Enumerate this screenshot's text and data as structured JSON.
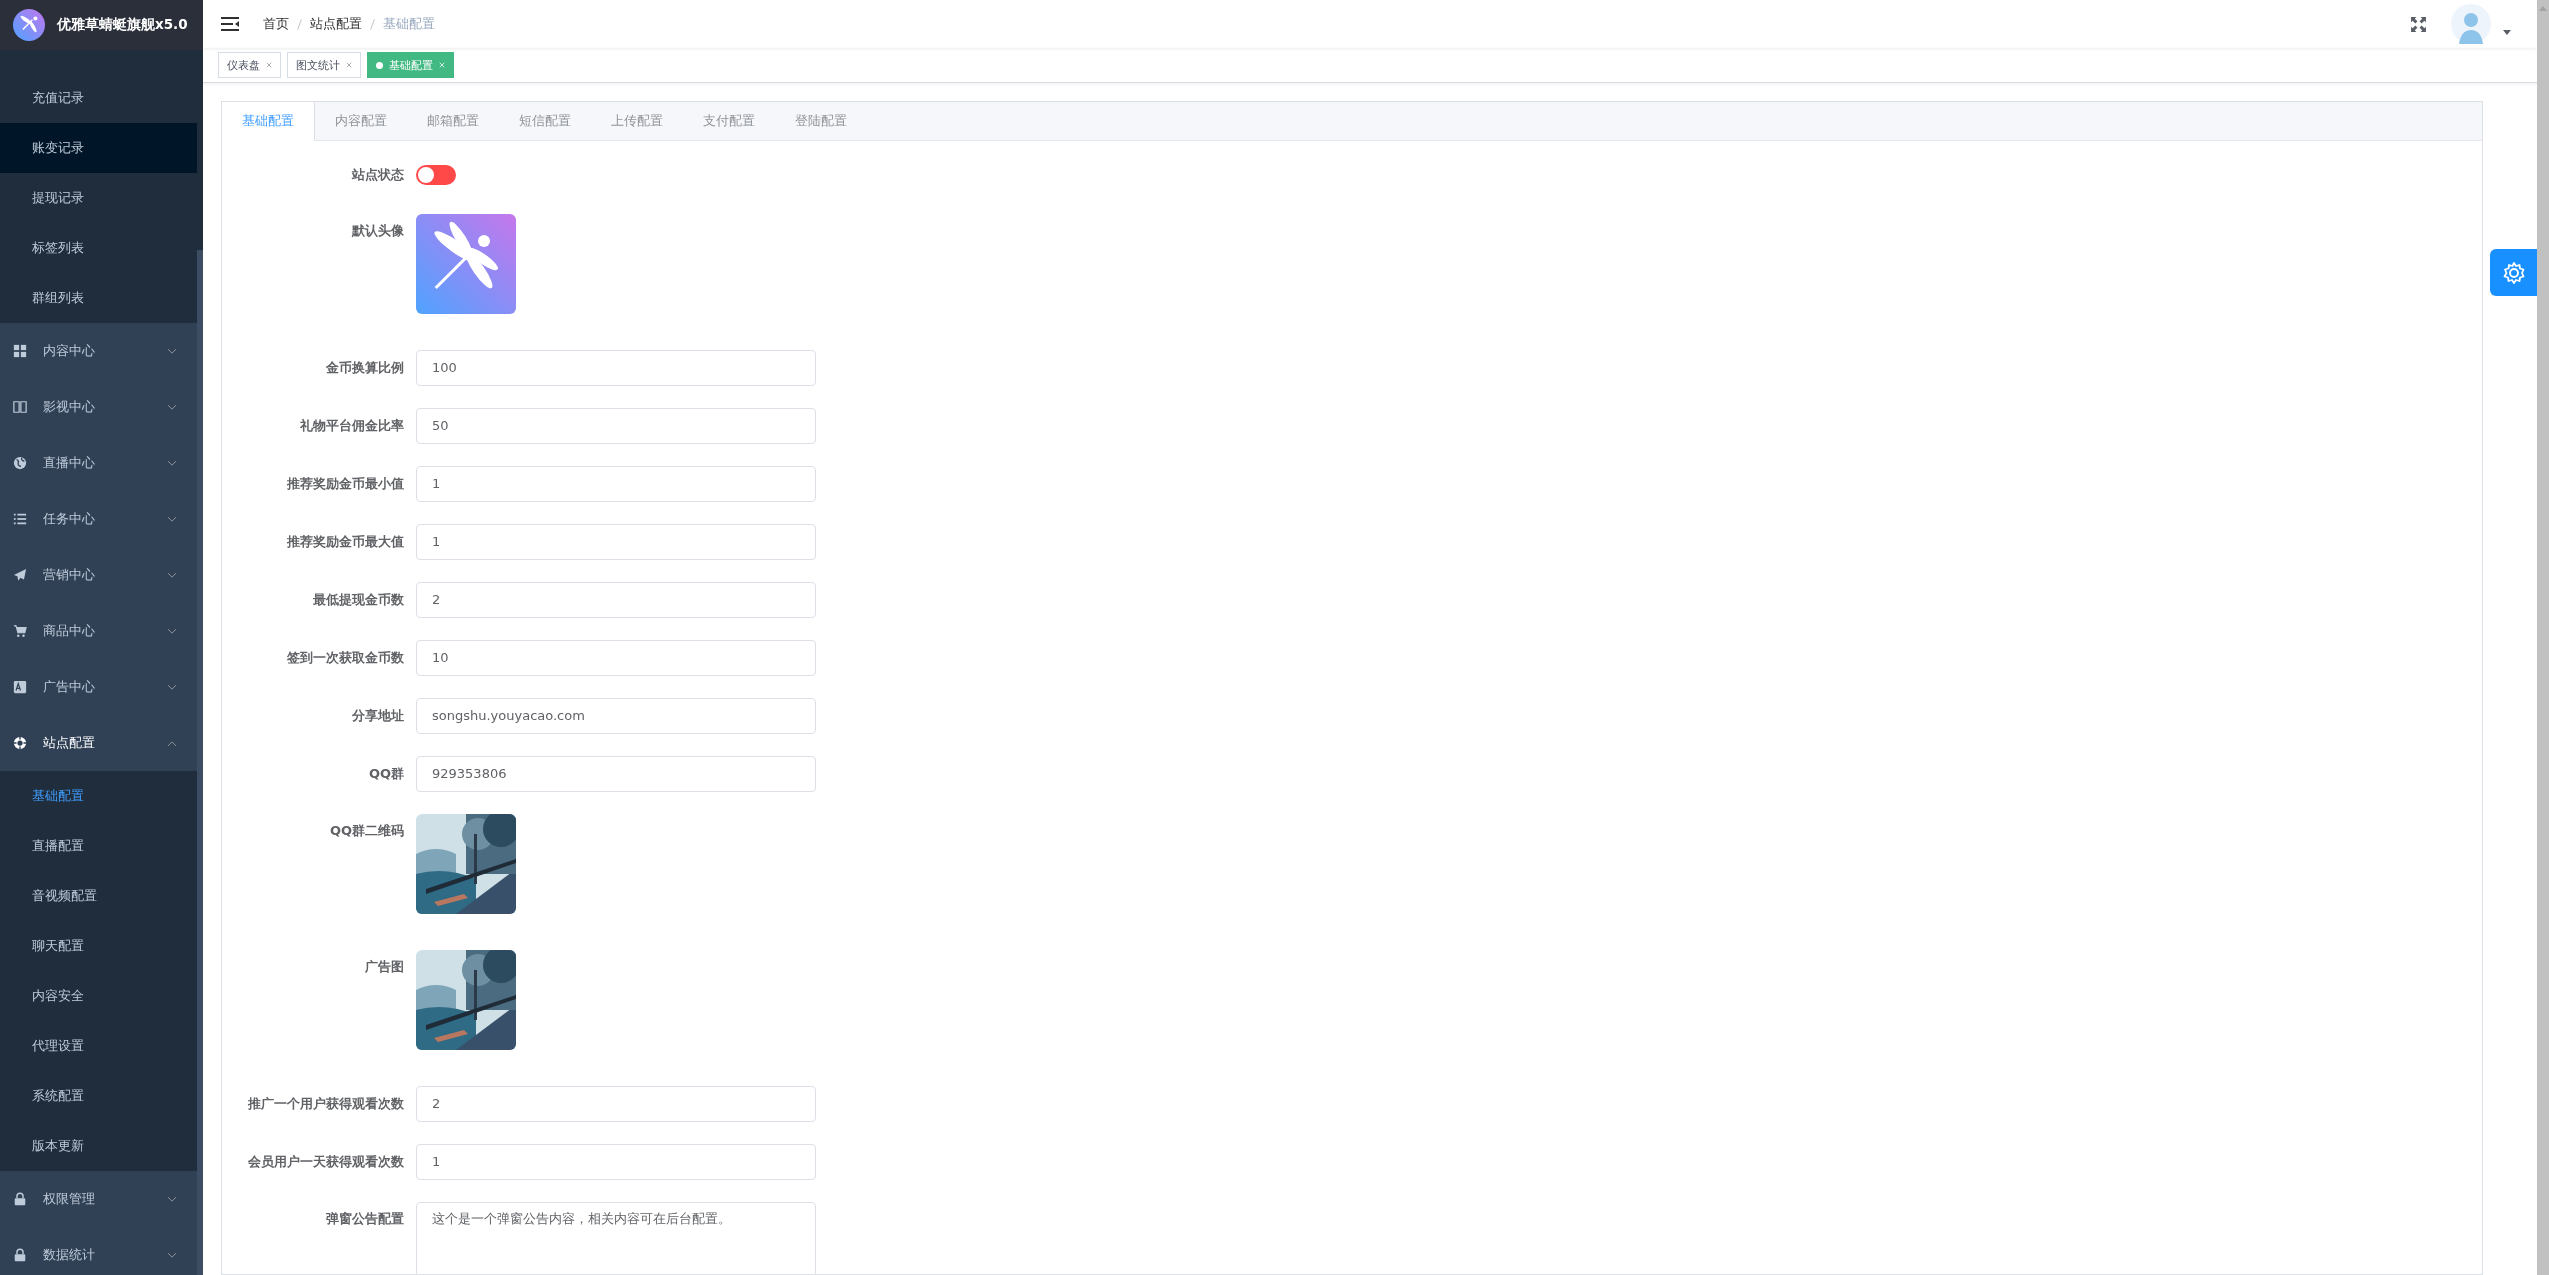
{
  "app": {
    "title": "优雅草蜻蜓旗舰x5.0"
  },
  "sidebar": {
    "items": [
      {
        "kind": "sub",
        "label": "充值记录",
        "selected": false,
        "hovered": false
      },
      {
        "kind": "sub",
        "label": "账变记录",
        "selected": false,
        "hovered": true
      },
      {
        "kind": "sub",
        "label": "提现记录",
        "selected": false,
        "hovered": false
      },
      {
        "kind": "sub",
        "label": "标签列表",
        "selected": false,
        "hovered": false
      },
      {
        "kind": "sub",
        "label": "群组列表",
        "selected": false,
        "hovered": false
      },
      {
        "kind": "menu",
        "label": "内容中心",
        "expanded": false
      },
      {
        "kind": "menu",
        "label": "影视中心",
        "expanded": false
      },
      {
        "kind": "menu",
        "label": "直播中心",
        "expanded": false
      },
      {
        "kind": "menu",
        "label": "任务中心",
        "expanded": false
      },
      {
        "kind": "menu",
        "label": "营销中心",
        "expanded": false
      },
      {
        "kind": "menu",
        "label": "商品中心",
        "expanded": false
      },
      {
        "kind": "menu",
        "label": "广告中心",
        "expanded": false
      },
      {
        "kind": "menu",
        "label": "站点配置",
        "expanded": true,
        "children": [
          {
            "label": "基础配置",
            "selected": true,
            "hovered": false
          },
          {
            "label": "直播配置",
            "selected": false,
            "hovered": false
          },
          {
            "label": "音视频配置",
            "selected": false,
            "hovered": false
          },
          {
            "label": "聊天配置",
            "selected": false,
            "hovered": false
          },
          {
            "label": "内容安全",
            "selected": false,
            "hovered": false
          },
          {
            "label": "代理设置",
            "selected": false,
            "hovered": false
          },
          {
            "label": "系统配置",
            "selected": false,
            "hovered": false
          },
          {
            "label": "版本更新",
            "selected": false,
            "hovered": false
          }
        ]
      },
      {
        "kind": "menu",
        "label": "权限管理",
        "expanded": false
      },
      {
        "kind": "menu",
        "label": "数据统计",
        "expanded": false
      }
    ]
  },
  "header": {
    "breadcrumb": [
      "首页",
      "站点配置",
      "基础配置"
    ]
  },
  "tags": [
    {
      "label": "仪表盘",
      "selected": false
    },
    {
      "label": "图文统计",
      "selected": false
    },
    {
      "label": "基础配置",
      "selected": true
    }
  ],
  "tabs": [
    {
      "label": "基础配置",
      "selected": true
    },
    {
      "label": "内容配置",
      "selected": false
    },
    {
      "label": "邮箱配置",
      "selected": false
    },
    {
      "label": "短信配置",
      "selected": false
    },
    {
      "label": "上传配置",
      "selected": false
    },
    {
      "label": "支付配置",
      "selected": false
    },
    {
      "label": "登陆配置",
      "selected": false
    }
  ],
  "form": {
    "fields": [
      {
        "kind": "switch",
        "label": "站点状态",
        "on": false
      },
      {
        "kind": "logo",
        "label": "默认头像"
      },
      {
        "kind": "input",
        "label": "金币换算比例",
        "value": "100"
      },
      {
        "kind": "input",
        "label": "礼物平台佣金比率",
        "value": "50"
      },
      {
        "kind": "input",
        "label": "推荐奖励金币最小值",
        "value": "1"
      },
      {
        "kind": "input",
        "label": "推荐奖励金币最大值",
        "value": "1"
      },
      {
        "kind": "input",
        "label": "最低提现金币数",
        "value": "2"
      },
      {
        "kind": "input",
        "label": "签到一次获取金币数",
        "value": "10"
      },
      {
        "kind": "input",
        "label": "分享地址",
        "value": "songshu.youyacao.com"
      },
      {
        "kind": "input",
        "label": "QQ群",
        "value": "929353806"
      },
      {
        "label": "QQ群二维码"
      },
      {
        "label": "广告图"
      },
      {
        "kind": "input",
        "label": "推广一个用户获得观看次数",
        "value": "2"
      },
      {
        "kind": "input",
        "label": "会员用户一天获得观看次数",
        "value": "1"
      },
      {
        "kind": "textarea",
        "label": "弹窗公告配置",
        "value": "这个是一个弹窗公告内容，相关内容可在后台配置。"
      }
    ]
  }
}
